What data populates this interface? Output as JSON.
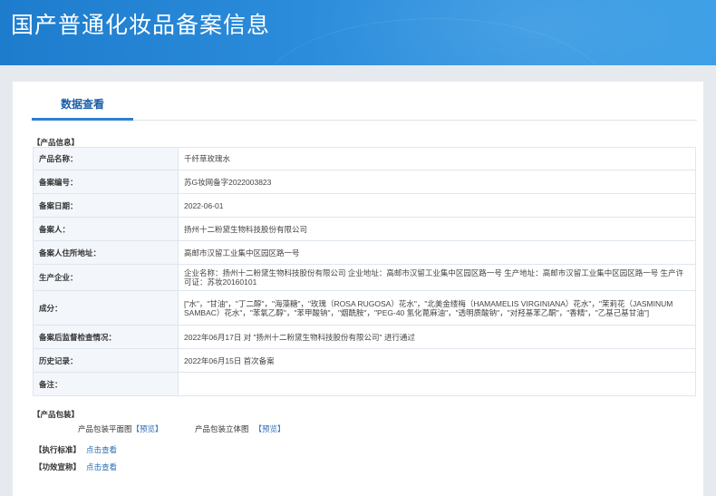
{
  "header": {
    "title": "国产普通化妆品备案信息"
  },
  "tab": {
    "label": "数据查看"
  },
  "product_info": {
    "section_title": "【产品信息】",
    "rows": [
      {
        "key": "产品名称：",
        "value": "千纤草玫瑰水"
      },
      {
        "key": "备案编号：",
        "value": "苏G妆网备字2022003823"
      },
      {
        "key": "备案日期：",
        "value": "2022-06-01"
      },
      {
        "key": "备案人：",
        "value": "扬州十二粉黛生物科技股份有限公司"
      },
      {
        "key": "备案人住所地址：",
        "value": "高邮市汉留工业集中区园区路一号"
      },
      {
        "key": "生产企业：",
        "value": "企业名称：扬州十二粉黛生物科技股份有限公司 企业地址：高邮市汉留工业集中区园区路一号 生产地址：高邮市汉留工业集中区园区路一号 生产许可证：苏妆20160101"
      },
      {
        "key": "成分：",
        "value": "[\"水\"，\"甘油\"，\"丁二醇\"，\"海藻糖\"，\"玫瑰（ROSA RUGOSA）花水\"，\"北美金缕梅（HAMAMELIS VIRGINIANA）花水\"，\"茉莉花（JASMINUM SAMBAC）花水\"，\"苯氧乙醇\"，\"苯甲酸钠\"，\"烟酰胺\"，\"PEG-40 氢化蓖麻油\"，\"透明质酸钠\"，\"对羟基苯乙酮\"，\"香精\"，\"乙基己基甘油\"]"
      },
      {
        "key": "备案后监督检查情况：",
        "value": "2022年06月17日 对 \"扬州十二粉黛生物科技股份有限公司\" 进行通过"
      },
      {
        "key": "历史记录：",
        "value": "2022年06月15日 首次备案"
      },
      {
        "key": "备注：",
        "value": ""
      }
    ]
  },
  "packaging": {
    "section_title": "【产品包装】",
    "flat_label": "产品包装平面图",
    "flat_link": "【预览】",
    "solid_label": "产品包装立体图",
    "solid_link": "【预览】"
  },
  "standard": {
    "label": "【执行标准】",
    "link": "点击查看"
  },
  "efficacy": {
    "label": "【功效宣称】",
    "link": "点击查看"
  },
  "colors": {
    "header": "#2c8ddc",
    "accent": "#1a5ea8",
    "link": "#2a6ab5",
    "table_border": "#a9c3de"
  }
}
